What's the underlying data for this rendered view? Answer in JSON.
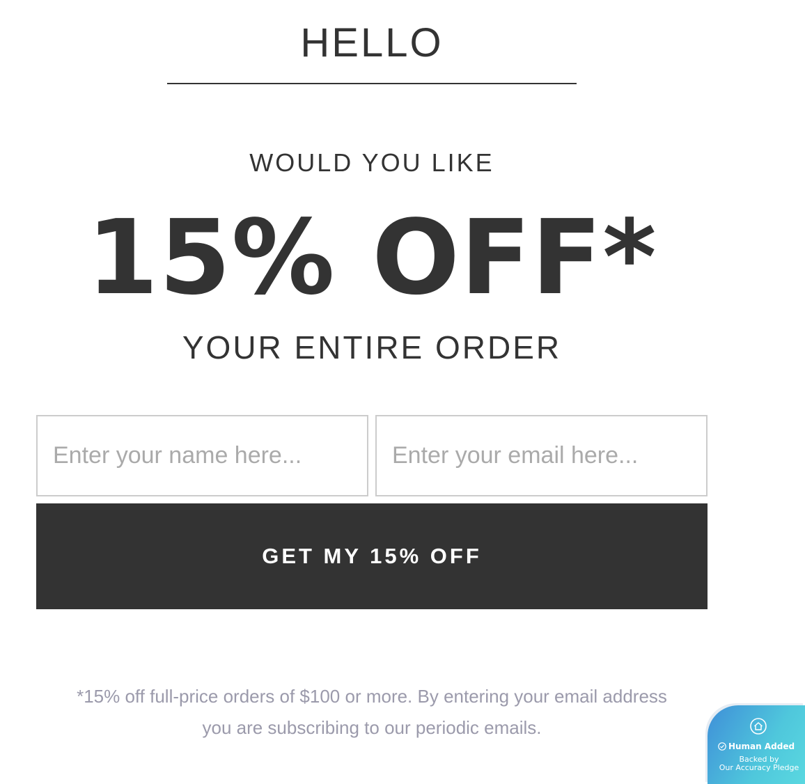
{
  "header": {
    "greeting": "HELLO"
  },
  "offer": {
    "intro": "WOULD YOU LIKE",
    "headline": "15% OFF*",
    "outro": "YOUR ENTIRE ORDER"
  },
  "form": {
    "name_placeholder": "Enter your name here...",
    "email_placeholder": "Enter your email here...",
    "submit_label": "GET MY 15% OFF"
  },
  "disclaimer": {
    "line1": "*15% off full-price orders of $100 or more. By entering your email address",
    "line2": "you are subscribing to our periodic emails."
  },
  "badge": {
    "icon": "home-icon",
    "check_icon": "check-circle-icon",
    "title": "Human Added",
    "sub_line1": "Backed by",
    "sub_line2": "Our Accuracy Pledge",
    "gradient_start": "#3f8fd8",
    "gradient_end": "#5ad8e0"
  },
  "colors": {
    "text": "#333333",
    "button_bg": "#333333",
    "button_text": "#ffffff",
    "input_border": "#cccccc",
    "placeholder": "#aaaaaa",
    "fine_print": "#9b9aab"
  }
}
